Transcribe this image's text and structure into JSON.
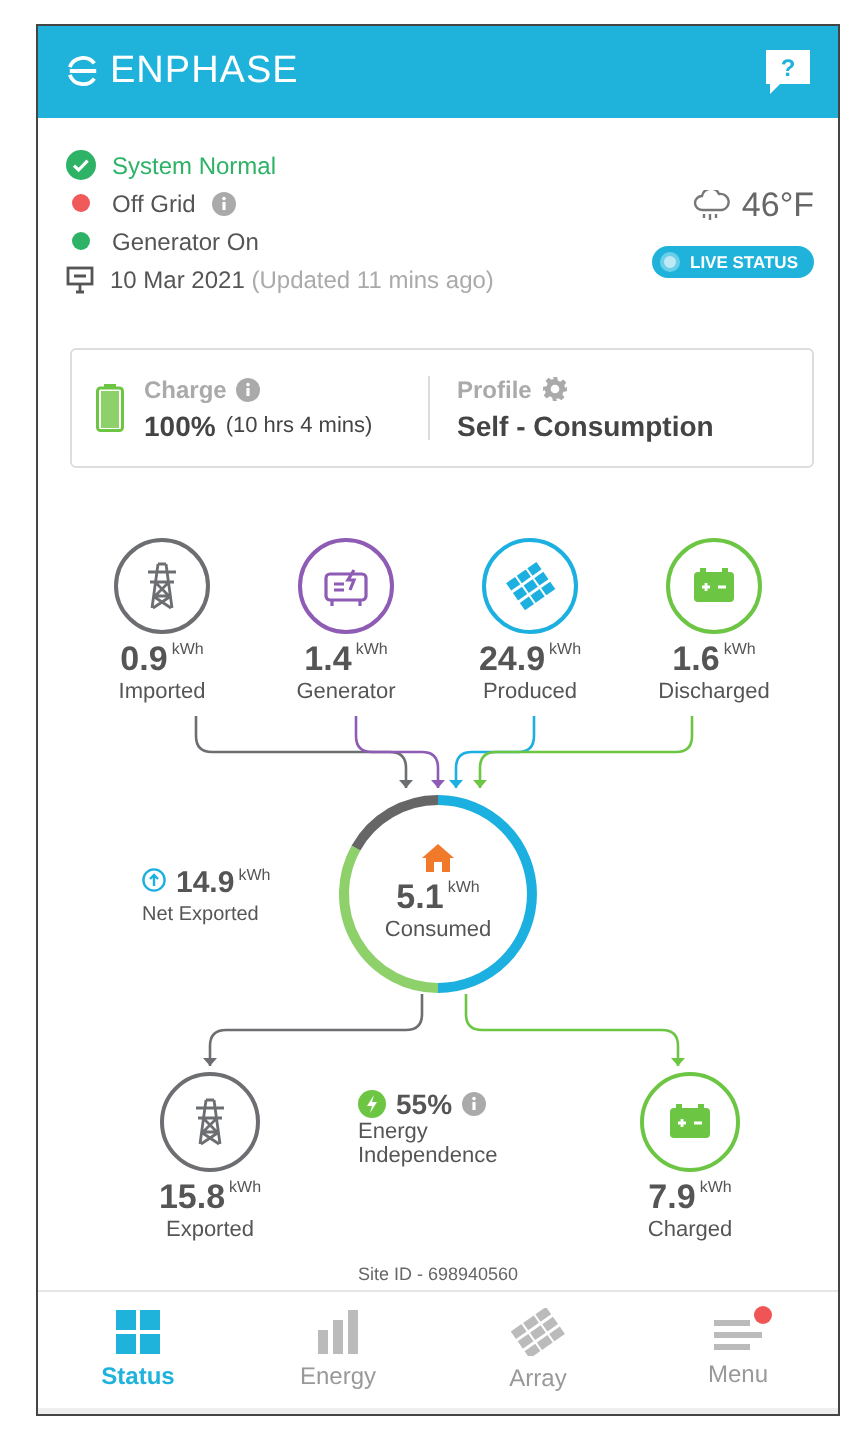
{
  "header": {
    "brand": "ENPHASE",
    "help": "?"
  },
  "status_items": [
    {
      "kind": "check",
      "text": "System Normal",
      "info": false
    },
    {
      "kind": "dot",
      "color": "#f05a5a",
      "text": "Off Grid",
      "info": true
    },
    {
      "kind": "dot",
      "color": "#2db266",
      "text": "Generator On",
      "info": false
    }
  ],
  "date": {
    "text": "10 Mar 2021",
    "updated": "(Updated 11 mins ago)"
  },
  "weather": {
    "temperature": "46°F"
  },
  "live_status": {
    "label": "LIVE STATUS"
  },
  "charge": {
    "label": "Charge",
    "value": "100%",
    "duration": "(10 hrs 4 mins)",
    "level": 1
  },
  "profile": {
    "label": "Profile",
    "value": "Self - Consumption"
  },
  "sources": [
    {
      "kind": "grid",
      "color": "#6d6e71",
      "value": "0.9",
      "unit": "kWh",
      "label": "Imported"
    },
    {
      "kind": "generator",
      "color": "#8e5bb5",
      "value": "1.4",
      "unit": "kWh",
      "label": "Generator"
    },
    {
      "kind": "solar",
      "color": "#1cb0e0",
      "value": "24.9",
      "unit": "kWh",
      "label": "Produced"
    },
    {
      "kind": "battery",
      "color": "#6cc644",
      "value": "1.6",
      "unit": "kWh",
      "label": "Discharged"
    }
  ],
  "net_exported": {
    "value": "14.9",
    "unit": "kWh",
    "label": "Net Exported"
  },
  "consumed": {
    "value": "5.1",
    "unit": "kWh",
    "label": "Consumed"
  },
  "outputs": [
    {
      "kind": "grid",
      "color": "#6d6e71",
      "value": "15.8",
      "unit": "kWh",
      "label": "Exported"
    },
    {
      "kind": "battery",
      "color": "#6cc644",
      "value": "7.9",
      "unit": "kWh",
      "label": "Charged"
    }
  ],
  "independence": {
    "value": "55%",
    "label": "Energy Independence"
  },
  "site_id": "Site ID - 698940560",
  "tabs": [
    {
      "kind": "status",
      "label": "Status",
      "selected": true,
      "notification": false
    },
    {
      "kind": "energy",
      "label": "Energy",
      "selected": false,
      "notification": false
    },
    {
      "kind": "array",
      "label": "Array",
      "selected": false,
      "notification": false
    },
    {
      "kind": "menu",
      "label": "Menu",
      "selected": false,
      "notification": true
    }
  ]
}
